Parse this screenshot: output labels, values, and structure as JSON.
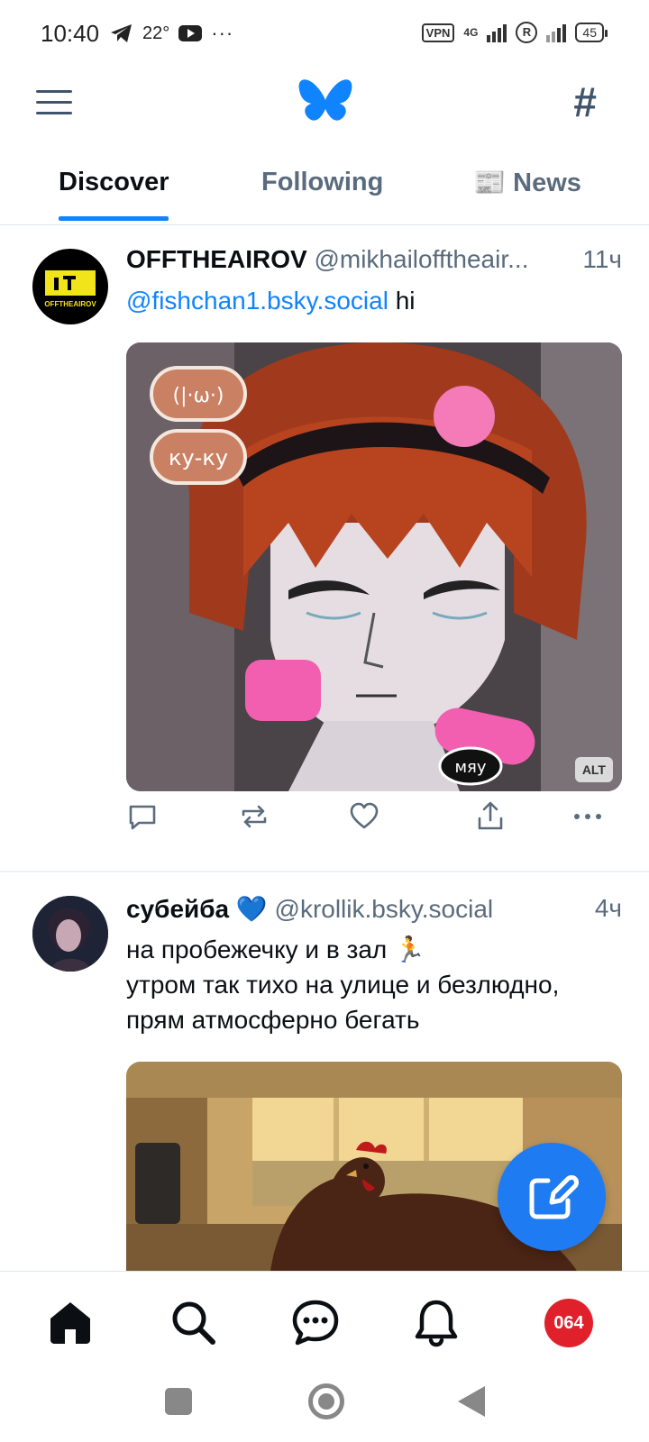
{
  "status_bar": {
    "time": "10:40",
    "temperature": "22°",
    "overflow": "···",
    "vpn": "VPN",
    "network": "4G",
    "roaming": "R",
    "battery": "45"
  },
  "header": {
    "menu_icon": "hamburger-menu-icon",
    "logo_icon": "butterfly-logo-icon",
    "feeds_icon": "hash-icon",
    "accent_color": "#1083fe"
  },
  "tabs": [
    {
      "label": "Discover",
      "active": true
    },
    {
      "label": "Following",
      "active": false
    },
    {
      "label": "📰 News",
      "active": false
    }
  ],
  "posts": [
    {
      "display_name": "OFFTHEAIROV",
      "handle": "@mikhailofftheair...",
      "time": "11ч",
      "mention": "@fishchan1.bsky.social",
      "text": " hi",
      "avatar_text": "OFFTHEAIROV",
      "media": {
        "alt_badge": "ALT",
        "stickers": [
          "(|·ω·)",
          "ку-ку",
          "мяу"
        ]
      },
      "actions": [
        "reply-icon",
        "repost-icon",
        "like-icon",
        "share-icon",
        "more-icon"
      ]
    },
    {
      "display_name": "субейба 💙",
      "handle": "@krollik.bsky.social",
      "time": "4ч",
      "text_lines": [
        "на пробежечку и в зал 🏃",
        "утром так тихо на улице и безлюдно,",
        "прям атмосферно бегать"
      ]
    }
  ],
  "fab": {
    "icon": "compose-icon"
  },
  "bottom_nav": {
    "items": [
      "home-icon",
      "search-icon",
      "chat-icon",
      "bell-icon"
    ],
    "profile_badge": "064"
  }
}
